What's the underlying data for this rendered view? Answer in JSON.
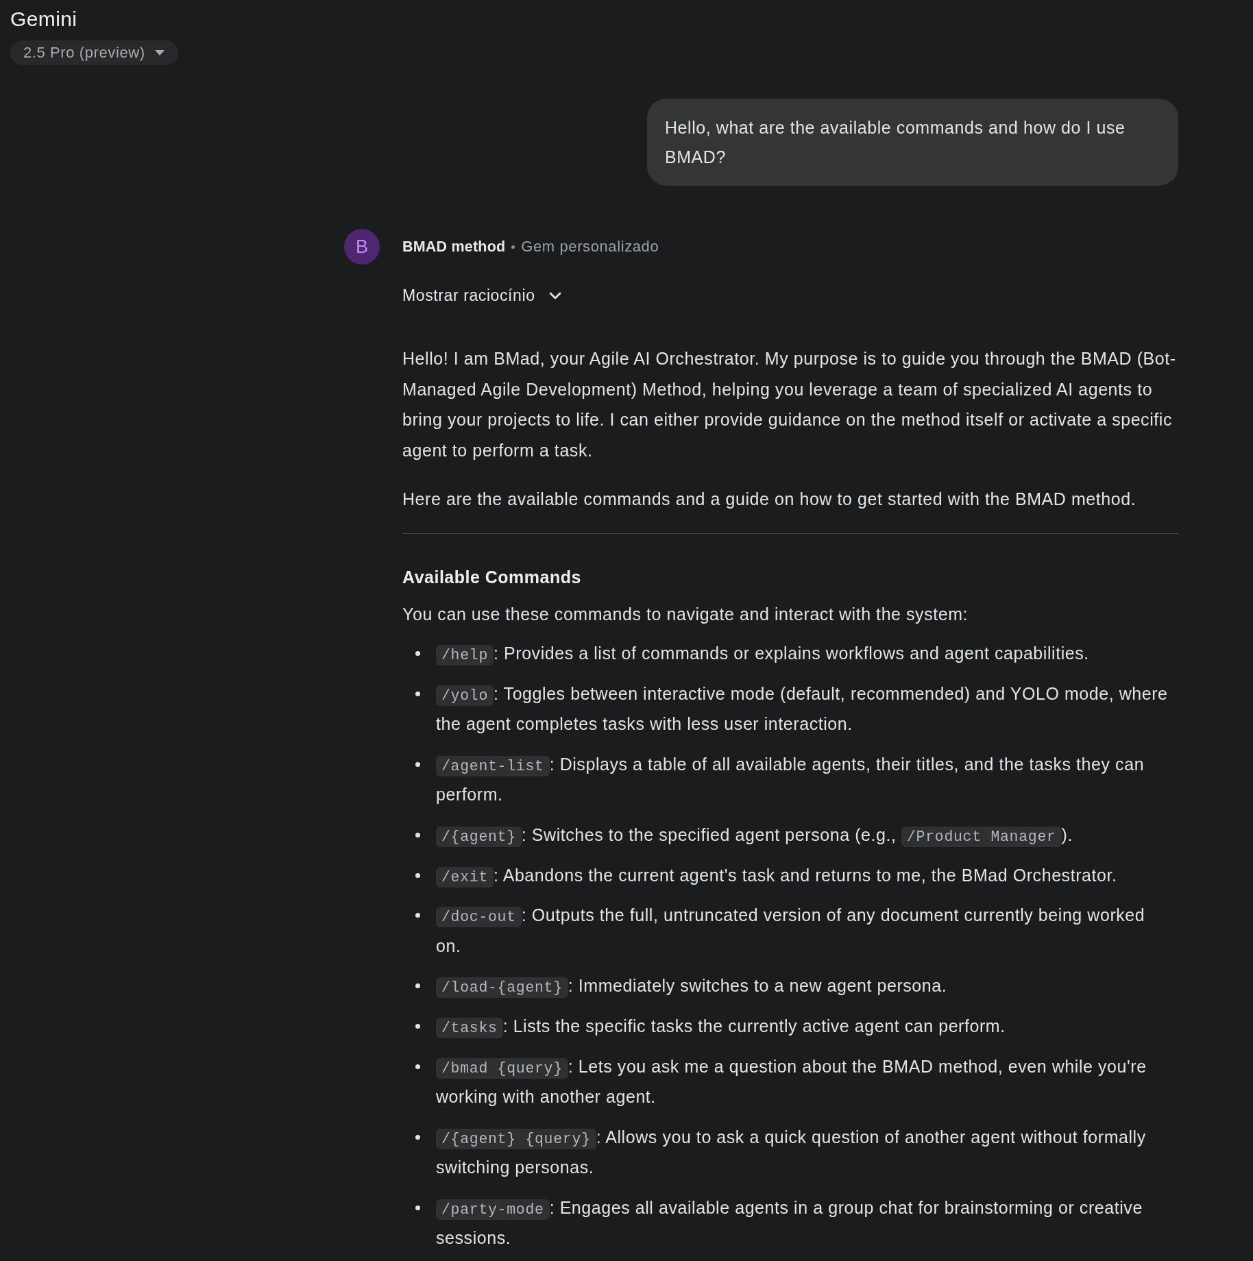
{
  "header": {
    "title": "Gemini",
    "model_selector": {
      "label": "2.5 Pro (preview)"
    }
  },
  "user_message": {
    "text": "Hello, what are the available commands and how do I use BMAD?"
  },
  "response": {
    "avatar": {
      "letter": "B"
    },
    "sender": "BMAD method",
    "sender_type": "Gem personalizado",
    "reasoning_toggle": {
      "label": "Mostrar raciocínio",
      "expanded": false
    },
    "paragraphs": [
      "Hello! I am BMad, your Agile AI Orchestrator. My purpose is to guide you through the BMAD (Bot-Managed Agile Development) Method, helping you leverage a team of specialized AI agents to bring your projects to life. I can either provide guidance on the method itself or activate a specific agent to perform a task.",
      "Here are the available commands and a guide on how to get started with the BMAD method."
    ],
    "section": {
      "heading": "Available Commands",
      "intro": "You can use these commands to navigate and interact with the system:",
      "items": [
        {
          "parts": [
            {
              "kind": "code",
              "text": "/help"
            },
            {
              "kind": "text",
              "text": ": Provides a list of commands or explains workflows and agent capabilities."
            }
          ]
        },
        {
          "parts": [
            {
              "kind": "code",
              "text": "/yolo"
            },
            {
              "kind": "text",
              "text": ": Toggles between interactive mode (default, recommended) and YOLO mode, where the agent completes tasks with less user interaction."
            }
          ]
        },
        {
          "parts": [
            {
              "kind": "code",
              "text": "/agent-list"
            },
            {
              "kind": "text",
              "text": ": Displays a table of all available agents, their titles, and the tasks they can perform."
            }
          ]
        },
        {
          "parts": [
            {
              "kind": "code",
              "text": "/{agent}"
            },
            {
              "kind": "text",
              "text": ": Switches to the specified agent persona (e.g., "
            },
            {
              "kind": "code",
              "text": "/Product Manager"
            },
            {
              "kind": "text",
              "text": ")."
            }
          ]
        },
        {
          "parts": [
            {
              "kind": "code",
              "text": "/exit"
            },
            {
              "kind": "text",
              "text": ": Abandons the current agent's task and returns to me, the BMad Orchestrator."
            }
          ]
        },
        {
          "parts": [
            {
              "kind": "code",
              "text": "/doc-out"
            },
            {
              "kind": "text",
              "text": ": Outputs the full, untruncated version of any document currently being worked on."
            }
          ]
        },
        {
          "parts": [
            {
              "kind": "code",
              "text": "/load-{agent}"
            },
            {
              "kind": "text",
              "text": ": Immediately switches to a new agent persona."
            }
          ]
        },
        {
          "parts": [
            {
              "kind": "code",
              "text": "/tasks"
            },
            {
              "kind": "text",
              "text": ": Lists the specific tasks the currently active agent can perform."
            }
          ]
        },
        {
          "parts": [
            {
              "kind": "code",
              "text": "/bmad {query}"
            },
            {
              "kind": "text",
              "text": ": Lets you ask me a question about the BMAD method, even while you're working with another agent."
            }
          ]
        },
        {
          "parts": [
            {
              "kind": "code",
              "text": "/{agent} {query}"
            },
            {
              "kind": "text",
              "text": ": Allows you to ask a quick question of another agent without formally switching personas."
            }
          ]
        },
        {
          "parts": [
            {
              "kind": "code",
              "text": "/party-mode"
            },
            {
              "kind": "text",
              "text": ": Engages all available agents in a group chat for brainstorming or creative sessions."
            }
          ]
        }
      ]
    }
  }
}
